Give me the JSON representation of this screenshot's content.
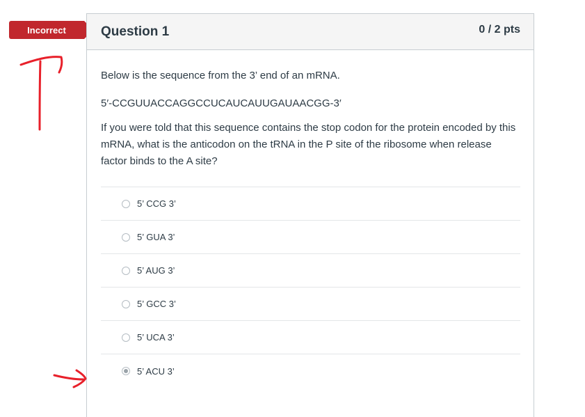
{
  "status_badge": "Incorrect",
  "question": {
    "title": "Question 1",
    "points": "0 / 2 pts",
    "intro": "Below is the sequence from the 3’ end of an mRNA.",
    "sequence": "5′-CCGUUACCAGGCCUCAUCAUUGAUAACGG-3′",
    "prompt": "If you were told that this sequence contains the stop codon for the protein encoded by this mRNA, what is the anticodon on the tRNA in the P site of the ribosome when release factor binds to the A site?"
  },
  "answers": [
    {
      "label": "5’ CCG 3’",
      "selected": false
    },
    {
      "label": "5’ GUA 3’",
      "selected": false
    },
    {
      "label": "5’ AUG 3’",
      "selected": false
    },
    {
      "label": "5’ GCC 3’",
      "selected": false
    },
    {
      "label": "5’ UCA 3’",
      "selected": false
    },
    {
      "label": "5’ ACU 3’",
      "selected": true
    }
  ],
  "annotation_color": "#e8202a"
}
